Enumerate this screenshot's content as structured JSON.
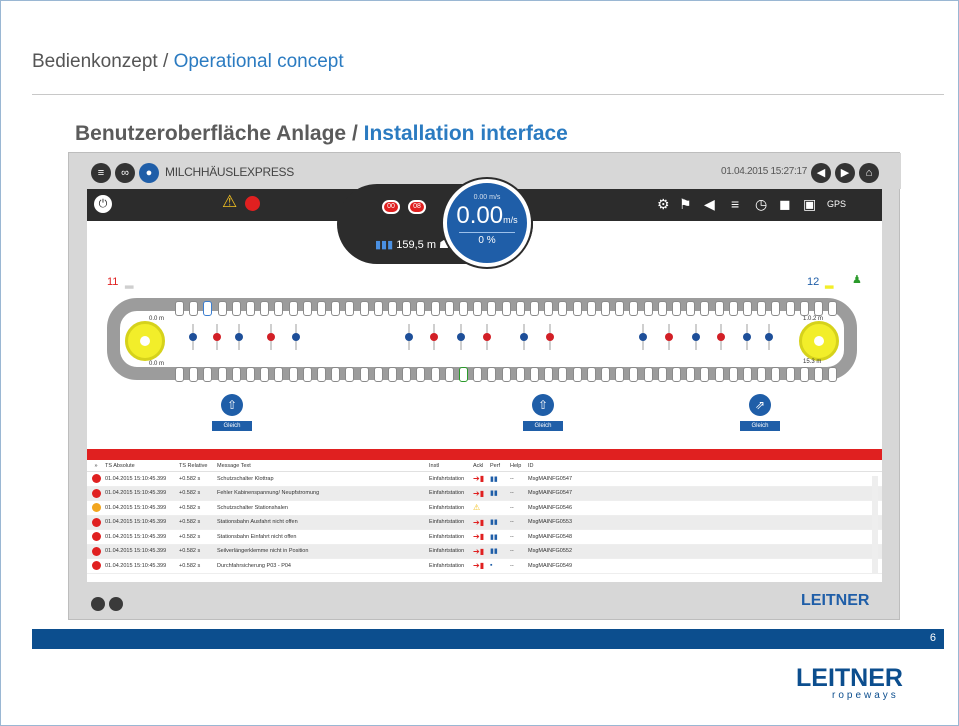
{
  "slide": {
    "title_de": "Bedienkonzept",
    "title_sep": " / ",
    "title_en": "Operational concept",
    "subtitle_de": "Benutzeroberfläche Anlage",
    "subtitle_sep": " / ",
    "subtitle_en": "Installation interface",
    "page_number": "6",
    "brand": "LEITNER",
    "brand_sub": "ropeways"
  },
  "app": {
    "name": "MILCHHÄUSLEXPRESS",
    "datetime": "01.04.2015 15:27:17",
    "speed_small": "0.00 m/s",
    "speed_value": "0.00",
    "speed_unit": "m/s",
    "speed_percent": "0 %",
    "distance": "159,5 m",
    "badge_left": "00",
    "badge_right": "08",
    "station_left": "11",
    "station_right": "12",
    "dist_left_top": "0.0 m",
    "dist_left_bottom": "0.0 m",
    "dist_right_top": "1.0.2 m",
    "dist_right_bottom": "15.3 m",
    "anchor_label": "Gleich",
    "brand": "LEITNER",
    "brand_sub": "ropeways"
  },
  "alarm": {
    "columns": [
      "TS Absolute",
      "TS Relative",
      "Message Text",
      "Instl",
      "Ackl",
      "Perf",
      "Help",
      "ID"
    ],
    "rows": [
      {
        "status": "red",
        "ts": "01.04.2015 15:10:45.399",
        "rel": "+0.582 s",
        "msg": "Schutzschalter Klottrap",
        "instl": "Einfahrtstation",
        "act": "arrow",
        "perf": "bars",
        "help": "--",
        "id": "MsgMAINFG0547"
      },
      {
        "status": "red",
        "ts": "01.04.2015 15:10:45.399",
        "rel": "+0.582 s",
        "msg": "Fehler Kabinenspannung/ Neupfstromung",
        "instl": "Einfahrtstation",
        "act": "arrow",
        "perf": "bars",
        "help": "--",
        "id": "MsgMAINFG0547"
      },
      {
        "status": "orange",
        "ts": "01.04.2015 15:10:45.399",
        "rel": "+0.582 s",
        "msg": "Schutzschalter Stationshalen",
        "instl": "Einfahrtstation",
        "act": "warn",
        "perf": "",
        "help": "--",
        "id": "MsgMAINFG0546"
      },
      {
        "status": "red",
        "ts": "01.04.2015 15:10:45.399",
        "rel": "+0.582 s",
        "msg": "Stationsbahn Ausfahrt nicht offen",
        "instl": "Einfahrtstation",
        "act": "arrow",
        "perf": "bars",
        "help": "--",
        "id": "MsgMAINFG0553"
      },
      {
        "status": "red",
        "ts": "01.04.2015 15:10:45.399",
        "rel": "+0.582 s",
        "msg": "Stationsbahn Einfahrt nicht offen",
        "instl": "Einfahrtstation",
        "act": "arrow",
        "perf": "bars",
        "help": "--",
        "id": "MsgMAINFG0548"
      },
      {
        "status": "red",
        "ts": "01.04.2015 15:10:45.399",
        "rel": "+0.582 s",
        "msg": "Seilverlängerklemme nicht in Position",
        "instl": "Einfahrtstation",
        "act": "arrow",
        "perf": "bars",
        "help": "--",
        "id": "MsgMAINFG0552"
      },
      {
        "status": "red",
        "ts": "01.04.2015 15:10:45.399",
        "rel": "+0.582 s",
        "msg": "Durchfahrsicherung P03 - P04",
        "instl": "Einfahrtstation",
        "act": "arrow",
        "perf": "dot",
        "help": "--",
        "id": "MsgMAINFG0549"
      }
    ]
  }
}
